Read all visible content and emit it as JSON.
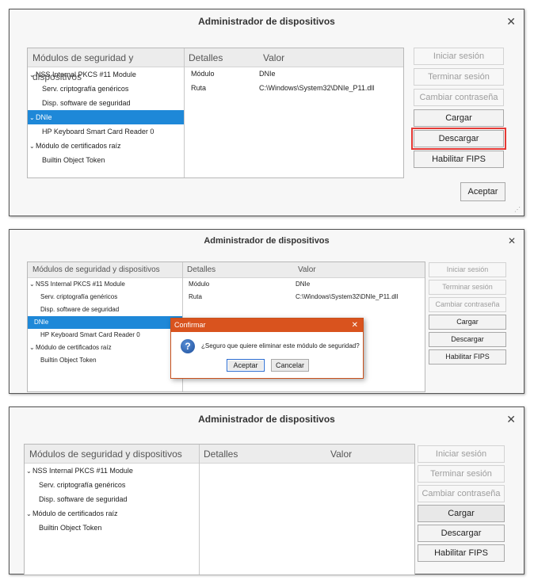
{
  "windows": [
    {
      "title": "Administrador de dispositivos",
      "close": "✕",
      "columns": {
        "modules": "Módulos de seguridad y dispositivos",
        "details": "Detalles",
        "value": "Valor"
      },
      "tree": [
        {
          "label": "NSS Internal PKCS #11 Module",
          "caret": "⌄"
        },
        {
          "label": "Serv. criptografía genéricos",
          "caret": ""
        },
        {
          "label": "Disp. software de seguridad",
          "caret": ""
        },
        {
          "label": "DNIe",
          "caret": "⌄"
        },
        {
          "label": "HP Keyboard Smart Card Reader 0",
          "caret": ""
        },
        {
          "label": "Módulo de certificados raíz",
          "caret": "⌄"
        },
        {
          "label": "Builtin Object Token",
          "caret": ""
        }
      ],
      "details": [
        {
          "key": "Módulo",
          "value": "DNIe"
        },
        {
          "key": "Ruta",
          "value": "C:\\Windows\\System32\\DNIe_P11.dll"
        }
      ],
      "buttons": [
        "Iniciar sesión",
        "Terminar sesión",
        "Cambiar contraseña",
        "Cargar",
        "Descargar",
        "Habilitar FIPS"
      ],
      "accept": "Aceptar"
    },
    {
      "title": "Administrador de dispositivos",
      "close": "✕",
      "columns": {
        "modules": "Módulos de seguridad y dispositivos",
        "details": "Detalles",
        "value": "Valor"
      },
      "tree": [
        {
          "label": "NSS Internal PKCS #11 Module",
          "caret": "⌄"
        },
        {
          "label": "Serv. criptografía genéricos",
          "caret": ""
        },
        {
          "label": "Disp. software de seguridad",
          "caret": ""
        },
        {
          "label": "DNIe",
          "caret": ""
        },
        {
          "label": "HP Keyboard Smart Card Reader 0",
          "caret": ""
        },
        {
          "label": "Módulo de certificados raíz",
          "caret": "⌄"
        },
        {
          "label": "Builtin Object Token",
          "caret": ""
        }
      ],
      "details": [
        {
          "key": "Módulo",
          "value": "DNIe"
        },
        {
          "key": "Ruta",
          "value": "C:\\Windows\\System32\\DNIe_P11.dll"
        }
      ],
      "buttons": [
        "Iniciar sesión",
        "Terminar sesión",
        "Cambiar contraseña",
        "Cargar",
        "Descargar",
        "Habilitar FIPS"
      ],
      "dialog": {
        "title": "Confirmar",
        "close": "✕",
        "icon": "?",
        "message": "¿Seguro que quiere eliminar este módulo de seguridad?",
        "ok": "Aceptar",
        "cancel": "Cancelar"
      }
    },
    {
      "title": "Administrador de dispositivos",
      "close": "✕",
      "columns": {
        "modules": "Módulos de seguridad y dispositivos",
        "details": "Detalles",
        "value": "Valor"
      },
      "tree": [
        {
          "label": "NSS Internal PKCS #11 Module",
          "caret": "⌄"
        },
        {
          "label": "Serv. criptografía genéricos",
          "caret": ""
        },
        {
          "label": "Disp. software de seguridad",
          "caret": ""
        },
        {
          "label": "Módulo de certificados raíz",
          "caret": "⌄"
        },
        {
          "label": "Builtin Object Token",
          "caret": ""
        }
      ],
      "buttons": [
        "Iniciar sesión",
        "Terminar sesión",
        "Cambiar contraseña",
        "Cargar",
        "Descargar",
        "Habilitar FIPS"
      ]
    }
  ],
  "colors": {
    "selection": "#1e88d8",
    "highlight": "#e53935",
    "dialog_title": "#d9531e"
  }
}
